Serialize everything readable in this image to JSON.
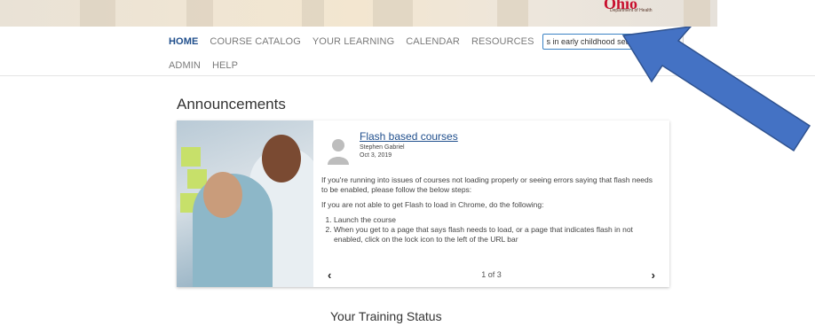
{
  "banner": {
    "logo_text": "Ohio",
    "dept_text": "Department of Health"
  },
  "nav": {
    "items": [
      "HOME",
      "COURSE CATALOG",
      "YOUR LEARNING",
      "CALENDAR",
      "RESOURCES"
    ],
    "row2": [
      "ADMIN",
      "HELP"
    ],
    "search_value": "s in early childhood settings",
    "close_label": "✖"
  },
  "announcements": {
    "heading": "Announcements",
    "post": {
      "title": "Flash based courses",
      "author": "Stephen Gabriel",
      "date": "Oct 3, 2019",
      "para1": "If you're running into issues of courses not loading properly or seeing errors saying that flash needs to be enabled, please follow the below steps:",
      "para2": "If you are not able to get Flash to load in Chrome, do the following:",
      "steps": [
        "Launch the course",
        "When you get to a page that says flash needs to load, or a page that indicates flash in not enabled, click on the lock icon to the left of the URL bar"
      ]
    },
    "pager": {
      "prev": "‹",
      "next": "›",
      "count": "1 of 3"
    }
  },
  "training_status_heading": "Your Training Status",
  "colors": {
    "accent": "#1f4e8c",
    "arrow": "#4472c4",
    "logo": "#c8102e"
  },
  "icons": [
    "close-icon",
    "avatar-placeholder-icon",
    "chevron-left-icon",
    "chevron-right-icon",
    "arrow-annotation"
  ]
}
